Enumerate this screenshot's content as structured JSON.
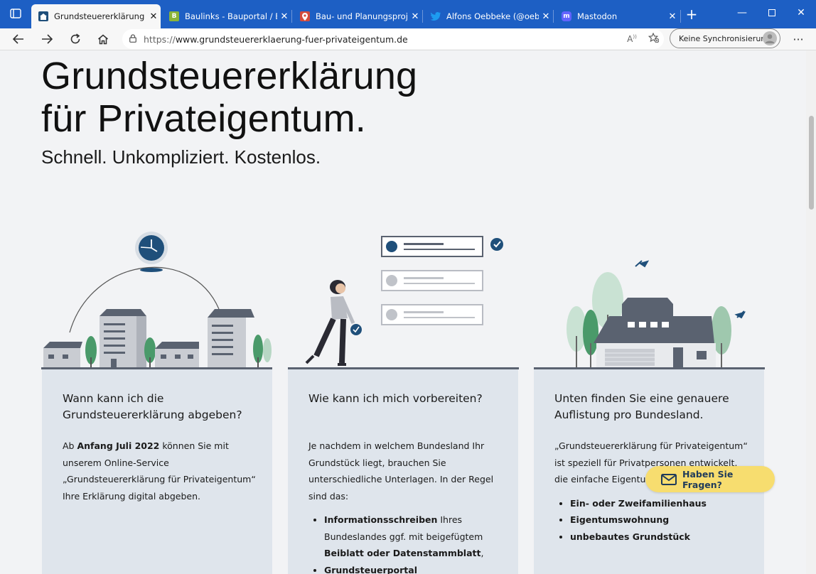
{
  "browser": {
    "tabs": [
      {
        "title": "Grundsteuererklärung für",
        "favicon": "G",
        "fav_color": "#1f4f7a",
        "active": true
      },
      {
        "title": "Baulinks - Bauportal / Bau",
        "favicon": "B",
        "fav_color": "#8bb43a",
        "active": false
      },
      {
        "title": "Bau- und Planungsprojekt",
        "favicon": "P",
        "fav_color": "#d34b3c",
        "active": false
      },
      {
        "title": "Alfons Oebbeke (@oebbe",
        "favicon": "t",
        "fav_color": "#1d9bf0",
        "active": false
      },
      {
        "title": "Mastodon",
        "favicon": "m",
        "fav_color": "#6364ff",
        "active": false
      }
    ],
    "url_prefix": "https://",
    "url": "www.grundsteuererklaerung-fuer-privateigentum.de",
    "sync_label": "Keine Synchronisierung"
  },
  "page": {
    "title_line1": "Grundsteuererklärung",
    "title_line2": "für Privateigentum.",
    "subtitle": "Schnell. Unkompliziert. Kostenlos.",
    "cards": [
      {
        "title": "Wann kann ich die Grundsteuererklärung abgeben?",
        "text_pre": "Ab ",
        "text_bold": "Anfang Juli 2022",
        "text_post": " können Sie mit unserem Online-Service „Grundsteuererklärung für Privateigentum“ Ihre Erklärung digital abgeben."
      },
      {
        "title": "Wie kann ich mich vorbereiten?",
        "text": "Je nachdem in welchem Bundesland Ihr Grundstück liegt, brauchen Sie unterschiedliche Unterlagen. In der Regel sind das:",
        "list": [
          {
            "bold": "Informationsschreiben",
            "normal": " Ihres Bundeslandes ggf. mit beigefügtem ",
            "bold2": "Beiblatt oder Datenstammblatt",
            "normal2": ","
          },
          {
            "bold": "Grundsteuerportal (Geodatenportal)",
            "normal": "",
            "bold2": "",
            "normal2": ""
          }
        ]
      },
      {
        "title": "Unten finden Sie eine genauere Auflistung pro Bundesland.",
        "text": "„Grundsteuererklärung für Privateigentum“ ist speziell für Privatpersonen entwickelt, die einfache Eigentumsverhältnisse haben:",
        "list": [
          "Ein- oder Zweifamilienhaus",
          "Eigentumswohnung",
          "unbebautes Grundstück"
        ]
      }
    ],
    "help_button": "Haben Sie Fragen?"
  },
  "colors": {
    "accent": "#1f4f7a",
    "tab_strip": "#1d5fc4",
    "card_bg": "#dfe5ec",
    "help_bg": "#f7dd6f"
  }
}
